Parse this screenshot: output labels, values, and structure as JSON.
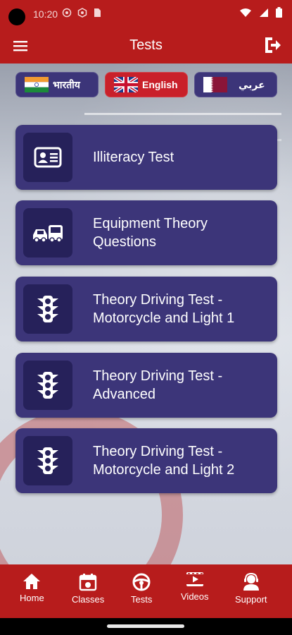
{
  "status_bar": {
    "time": "10:20"
  },
  "app_bar": {
    "title": "Tests"
  },
  "languages": [
    {
      "label": "भारतीय",
      "flag": "india-flag-icon"
    },
    {
      "label": "English",
      "flag": "uk-flag-icon",
      "selected": true
    },
    {
      "label": "عربي",
      "flag": "qatar-flag-icon"
    }
  ],
  "tests": [
    {
      "title": "Illiteracy Test",
      "icon": "id-card-icon"
    },
    {
      "title": "Equipment Theory Questions",
      "icon": "vehicles-icon"
    },
    {
      "title": "Theory Driving Test - Motorcycle and Light 1",
      "icon": "traffic-light-icon"
    },
    {
      "title": "Theory Driving Test - Advanced",
      "icon": "traffic-light-icon"
    },
    {
      "title": "Theory Driving Test - Motorcycle and Light 2",
      "icon": "traffic-light-icon"
    }
  ],
  "bottom_nav": [
    {
      "label": "Home",
      "icon": "home-icon"
    },
    {
      "label": "Classes",
      "icon": "calendar-icon"
    },
    {
      "label": "Tests",
      "icon": "steering-wheel-icon"
    },
    {
      "label": "Videos",
      "icon": "video-icon"
    },
    {
      "label": "Support",
      "icon": "support-agent-icon"
    }
  ],
  "colors": {
    "primary_red": "#b71c1c",
    "card_purple": "#3c3579",
    "icon_box": "#26215a",
    "active_lang": "#c9202a"
  }
}
